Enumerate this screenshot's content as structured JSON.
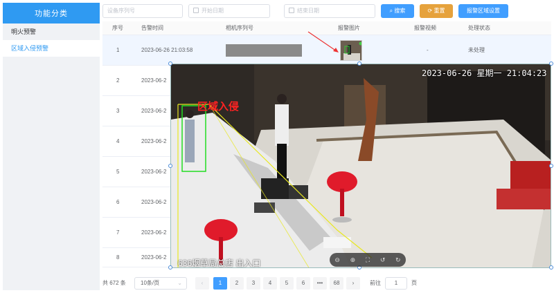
{
  "sidebar": {
    "title": "功能分类",
    "items": [
      {
        "label": "明火预警",
        "active": false
      },
      {
        "label": "区域入侵预警",
        "active": true
      }
    ]
  },
  "toolbar": {
    "serial_placeholder": "设备序列号",
    "start_date_placeholder": "开始日期",
    "end_date_placeholder": "结束日期",
    "search_label": "搜索",
    "reset_label": "重置",
    "region_label": "报警区域设置"
  },
  "table": {
    "headers": [
      "序号",
      "告警时间",
      "相机序列号",
      "报警图片",
      "报警视频",
      "处理状态"
    ],
    "rows": [
      {
        "no": "1",
        "time": "2023-06-26 21:03:58",
        "video": "-",
        "status": "未处理"
      },
      {
        "no": "2",
        "time": "2023-06-2"
      },
      {
        "no": "3",
        "time": "2023-06-2"
      },
      {
        "no": "4",
        "time": "2023-06-2"
      },
      {
        "no": "5",
        "time": "2023-06-2"
      },
      {
        "no": "6",
        "time": "2023-06-2"
      },
      {
        "no": "7",
        "time": "2023-06-2"
      },
      {
        "no": "8",
        "time": "2023-06-2"
      }
    ]
  },
  "preview": {
    "timestamp": "2023-06-26 星期一 21:04:23",
    "alert_label": "区域入侵",
    "camera_caption": "636烟草局总店 出入口"
  },
  "pagination": {
    "total": "共 672 条",
    "page_size": "10条/页",
    "pages": [
      "1",
      "2",
      "3",
      "4",
      "5",
      "6",
      "•••",
      "68"
    ],
    "goto_prefix": "前往",
    "goto_value": "1",
    "goto_suffix": "页"
  },
  "colors": {
    "primary": "#409eff",
    "warning": "#e6a23c",
    "sidebar_head": "#2f9af2"
  }
}
